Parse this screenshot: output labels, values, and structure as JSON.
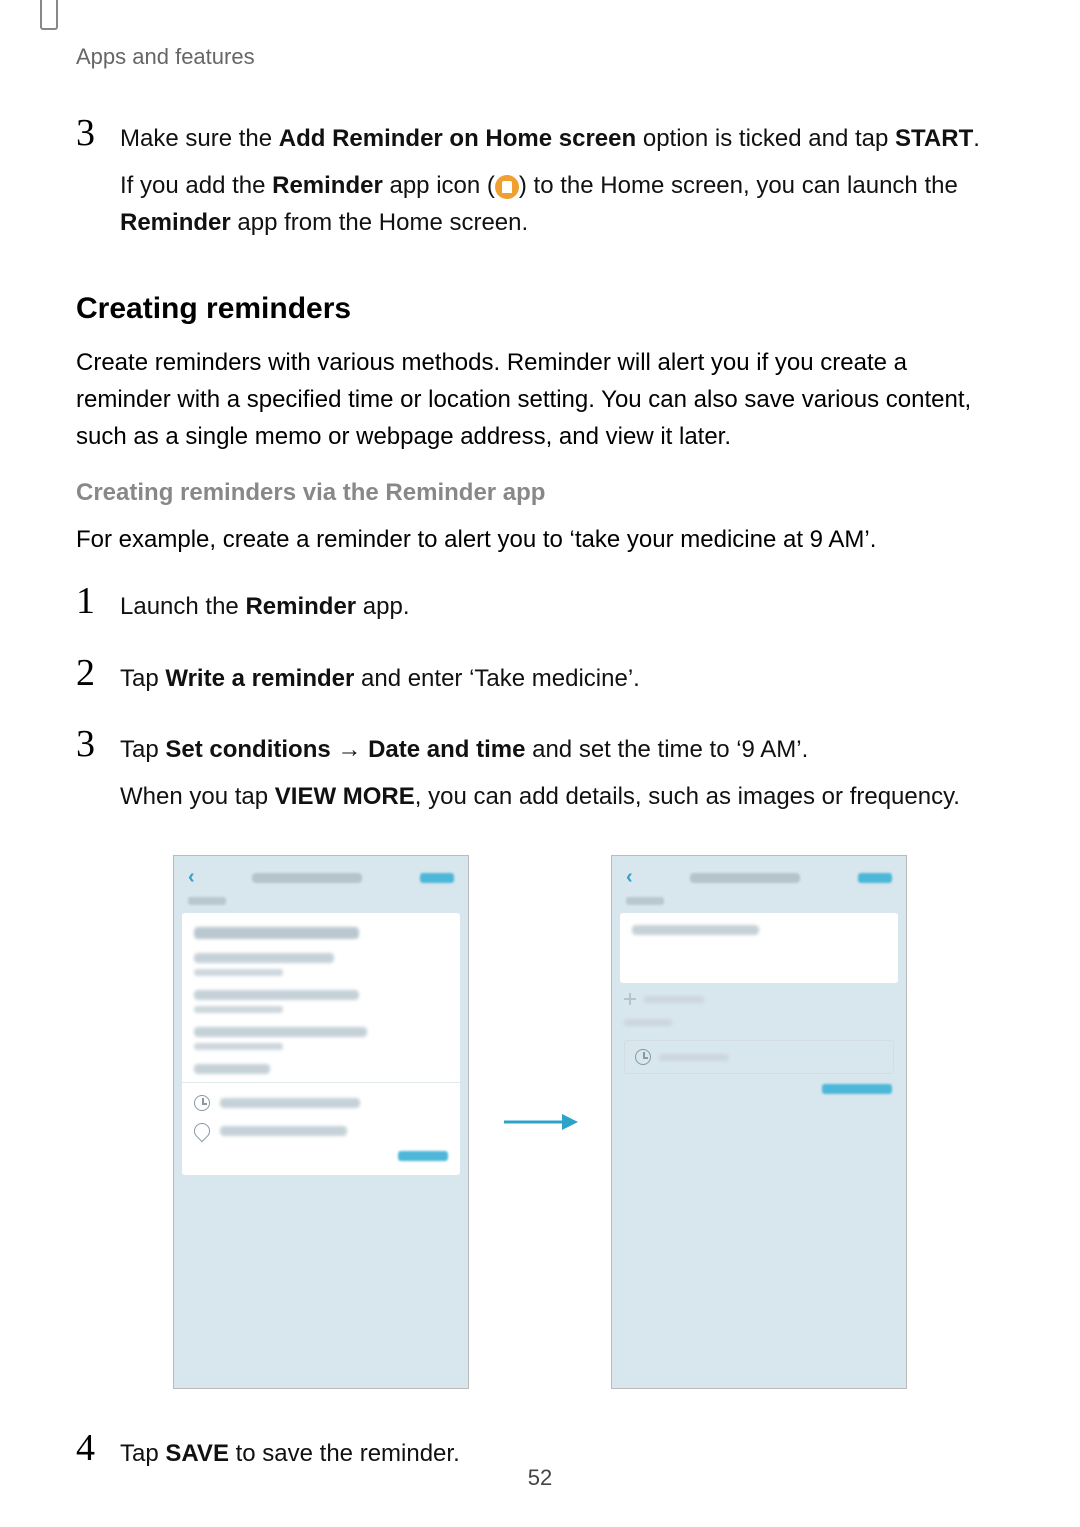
{
  "header": {
    "section": "Apps and features"
  },
  "step3a": {
    "num": "3",
    "line1_pre": "Make sure the ",
    "line1_bold1": "Add Reminder on Home screen",
    "line1_mid": " option is ticked and tap ",
    "line1_bold2": "START",
    "line1_end": ".",
    "line2_pre": "If you add the ",
    "line2_bold1": "Reminder",
    "line2_mid1": " app icon (",
    "line2_mid2": ") to the Home screen, you can launch the ",
    "line2_bold2": "Reminder",
    "line2_end": " app from the Home screen."
  },
  "h2": "Creating reminders",
  "para1": "Create reminders with various methods. Reminder will alert you if you create a reminder with a specified time or location setting. You can also save various content, such as a single memo or webpage address, and view it later.",
  "h3": "Creating reminders via the Reminder app",
  "para2": "For example, create a reminder to alert you to ‘take your medicine at 9 AM’.",
  "steps": {
    "s1": {
      "num": "1",
      "pre": "Launch the ",
      "bold": "Reminder",
      "end": " app."
    },
    "s2": {
      "num": "2",
      "pre": "Tap ",
      "bold": "Write a reminder",
      "end": " and enter ‘Take medicine’."
    },
    "s3": {
      "num": "3",
      "l1_pre": "Tap ",
      "l1_b1": "Set conditions",
      "l1_arrow": " → ",
      "l1_b2": "Date and time",
      "l1_end": " and set the time to ‘9 AM’.",
      "l2_pre": "When you tap ",
      "l2_b": "VIEW MORE",
      "l2_end": ", you can add details, such as images or frequency."
    },
    "s4": {
      "num": "4",
      "pre": "Tap ",
      "bold": "SAVE",
      "end": " to save the reminder."
    }
  },
  "pageNumber": "52"
}
